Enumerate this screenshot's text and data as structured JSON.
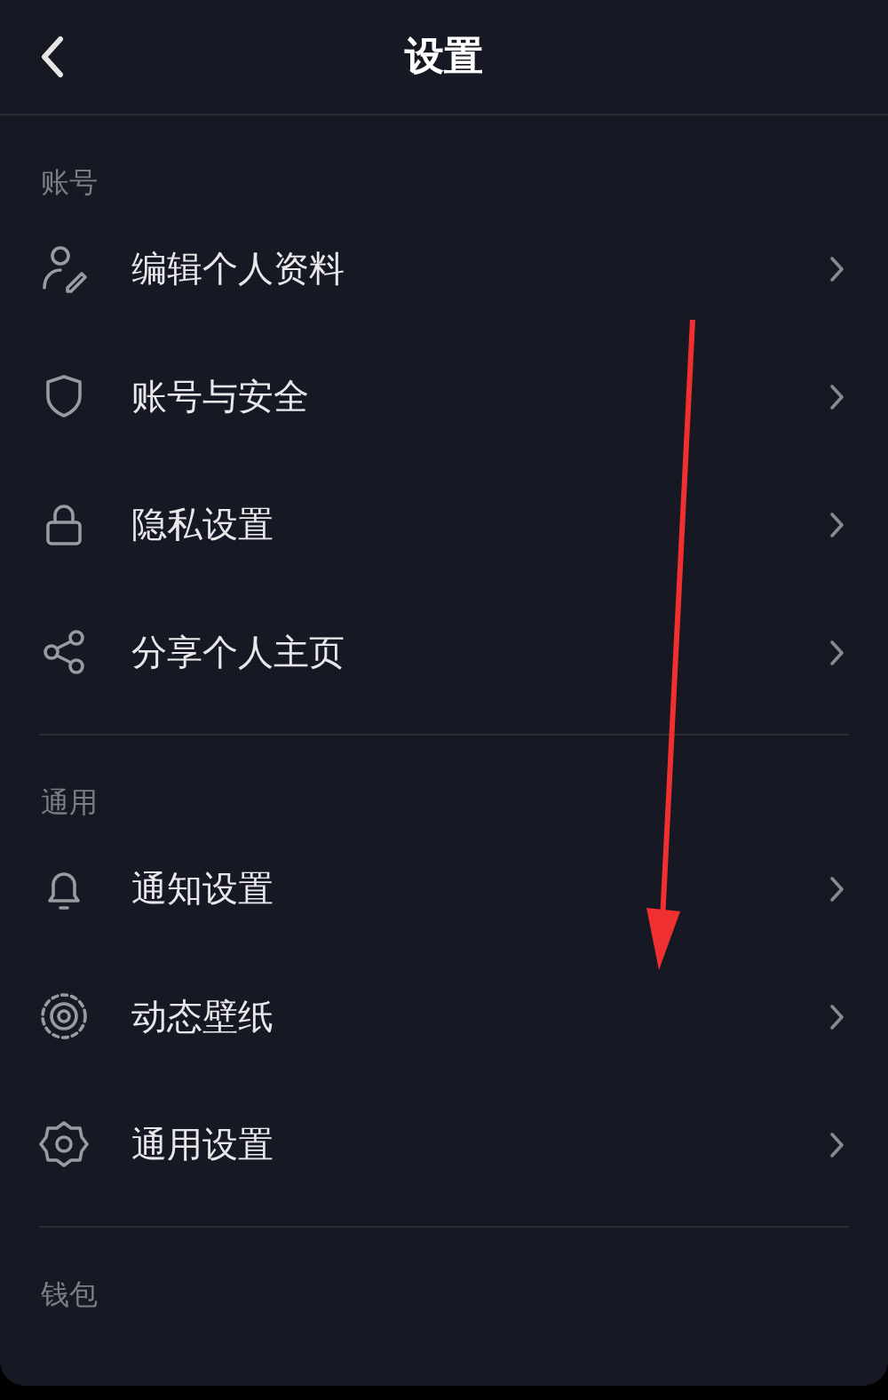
{
  "header": {
    "title": "设置"
  },
  "sections": [
    {
      "label": "账号",
      "items": [
        {
          "label": "编辑个人资料"
        },
        {
          "label": "账号与安全"
        },
        {
          "label": "隐私设置"
        },
        {
          "label": "分享个人主页"
        }
      ]
    },
    {
      "label": "通用",
      "items": [
        {
          "label": "通知设置"
        },
        {
          "label": "动态壁纸"
        },
        {
          "label": "通用设置"
        }
      ]
    },
    {
      "label": "钱包"
    }
  ]
}
